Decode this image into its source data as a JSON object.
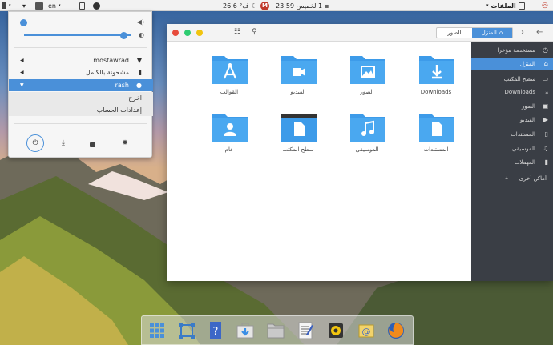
{
  "top_panel": {
    "files_app_label": "الملفات",
    "clock": "23:59 الخميس",
    "notification_count": "1",
    "weather": "26.6 °ف",
    "mail_badge": "M",
    "language": "en"
  },
  "system_menu": {
    "volume_level": 0.02,
    "brightness_level": 1.0,
    "rows": {
      "wifi": "mostawrad",
      "battery": "مشحونة بالكامل",
      "user": "rash",
      "logout": "اخرج",
      "account_settings": "إعدادات الحساب"
    }
  },
  "file_manager": {
    "breadcrumb": {
      "home": "المنزل",
      "current": "الصور"
    },
    "folders": [
      {
        "name": "Downloads",
        "icon": "download-icon"
      },
      {
        "name": "الصور",
        "icon": "image-icon"
      },
      {
        "name": "الفيديو",
        "icon": "video-icon"
      },
      {
        "name": "القوالب",
        "icon": "template-icon"
      },
      {
        "name": "المستندات",
        "icon": "document-icon"
      },
      {
        "name": "الموسيقى",
        "icon": "music-icon"
      },
      {
        "name": "سطح المكتب",
        "icon": "desktop-icon"
      },
      {
        "name": "عام",
        "icon": "user-icon"
      }
    ],
    "sidebar": {
      "recent": "مستخدمة مؤخرا",
      "home": "المنزل",
      "desktop": "سطح المكتب",
      "downloads": "Downloads",
      "pictures": "الصور",
      "videos": "الفيديو",
      "documents": "المستندات",
      "music": "الموسيقى",
      "trash": "المهملات",
      "other_places": "أماكن أخرى"
    }
  },
  "colors": {
    "accent": "#4a90d9",
    "folder_blue": "#3d9be9",
    "sidebar_bg": "#3a3e45",
    "close": "#e74c3c",
    "maximize": "#2ecc71",
    "minimize": "#f1c40f"
  }
}
